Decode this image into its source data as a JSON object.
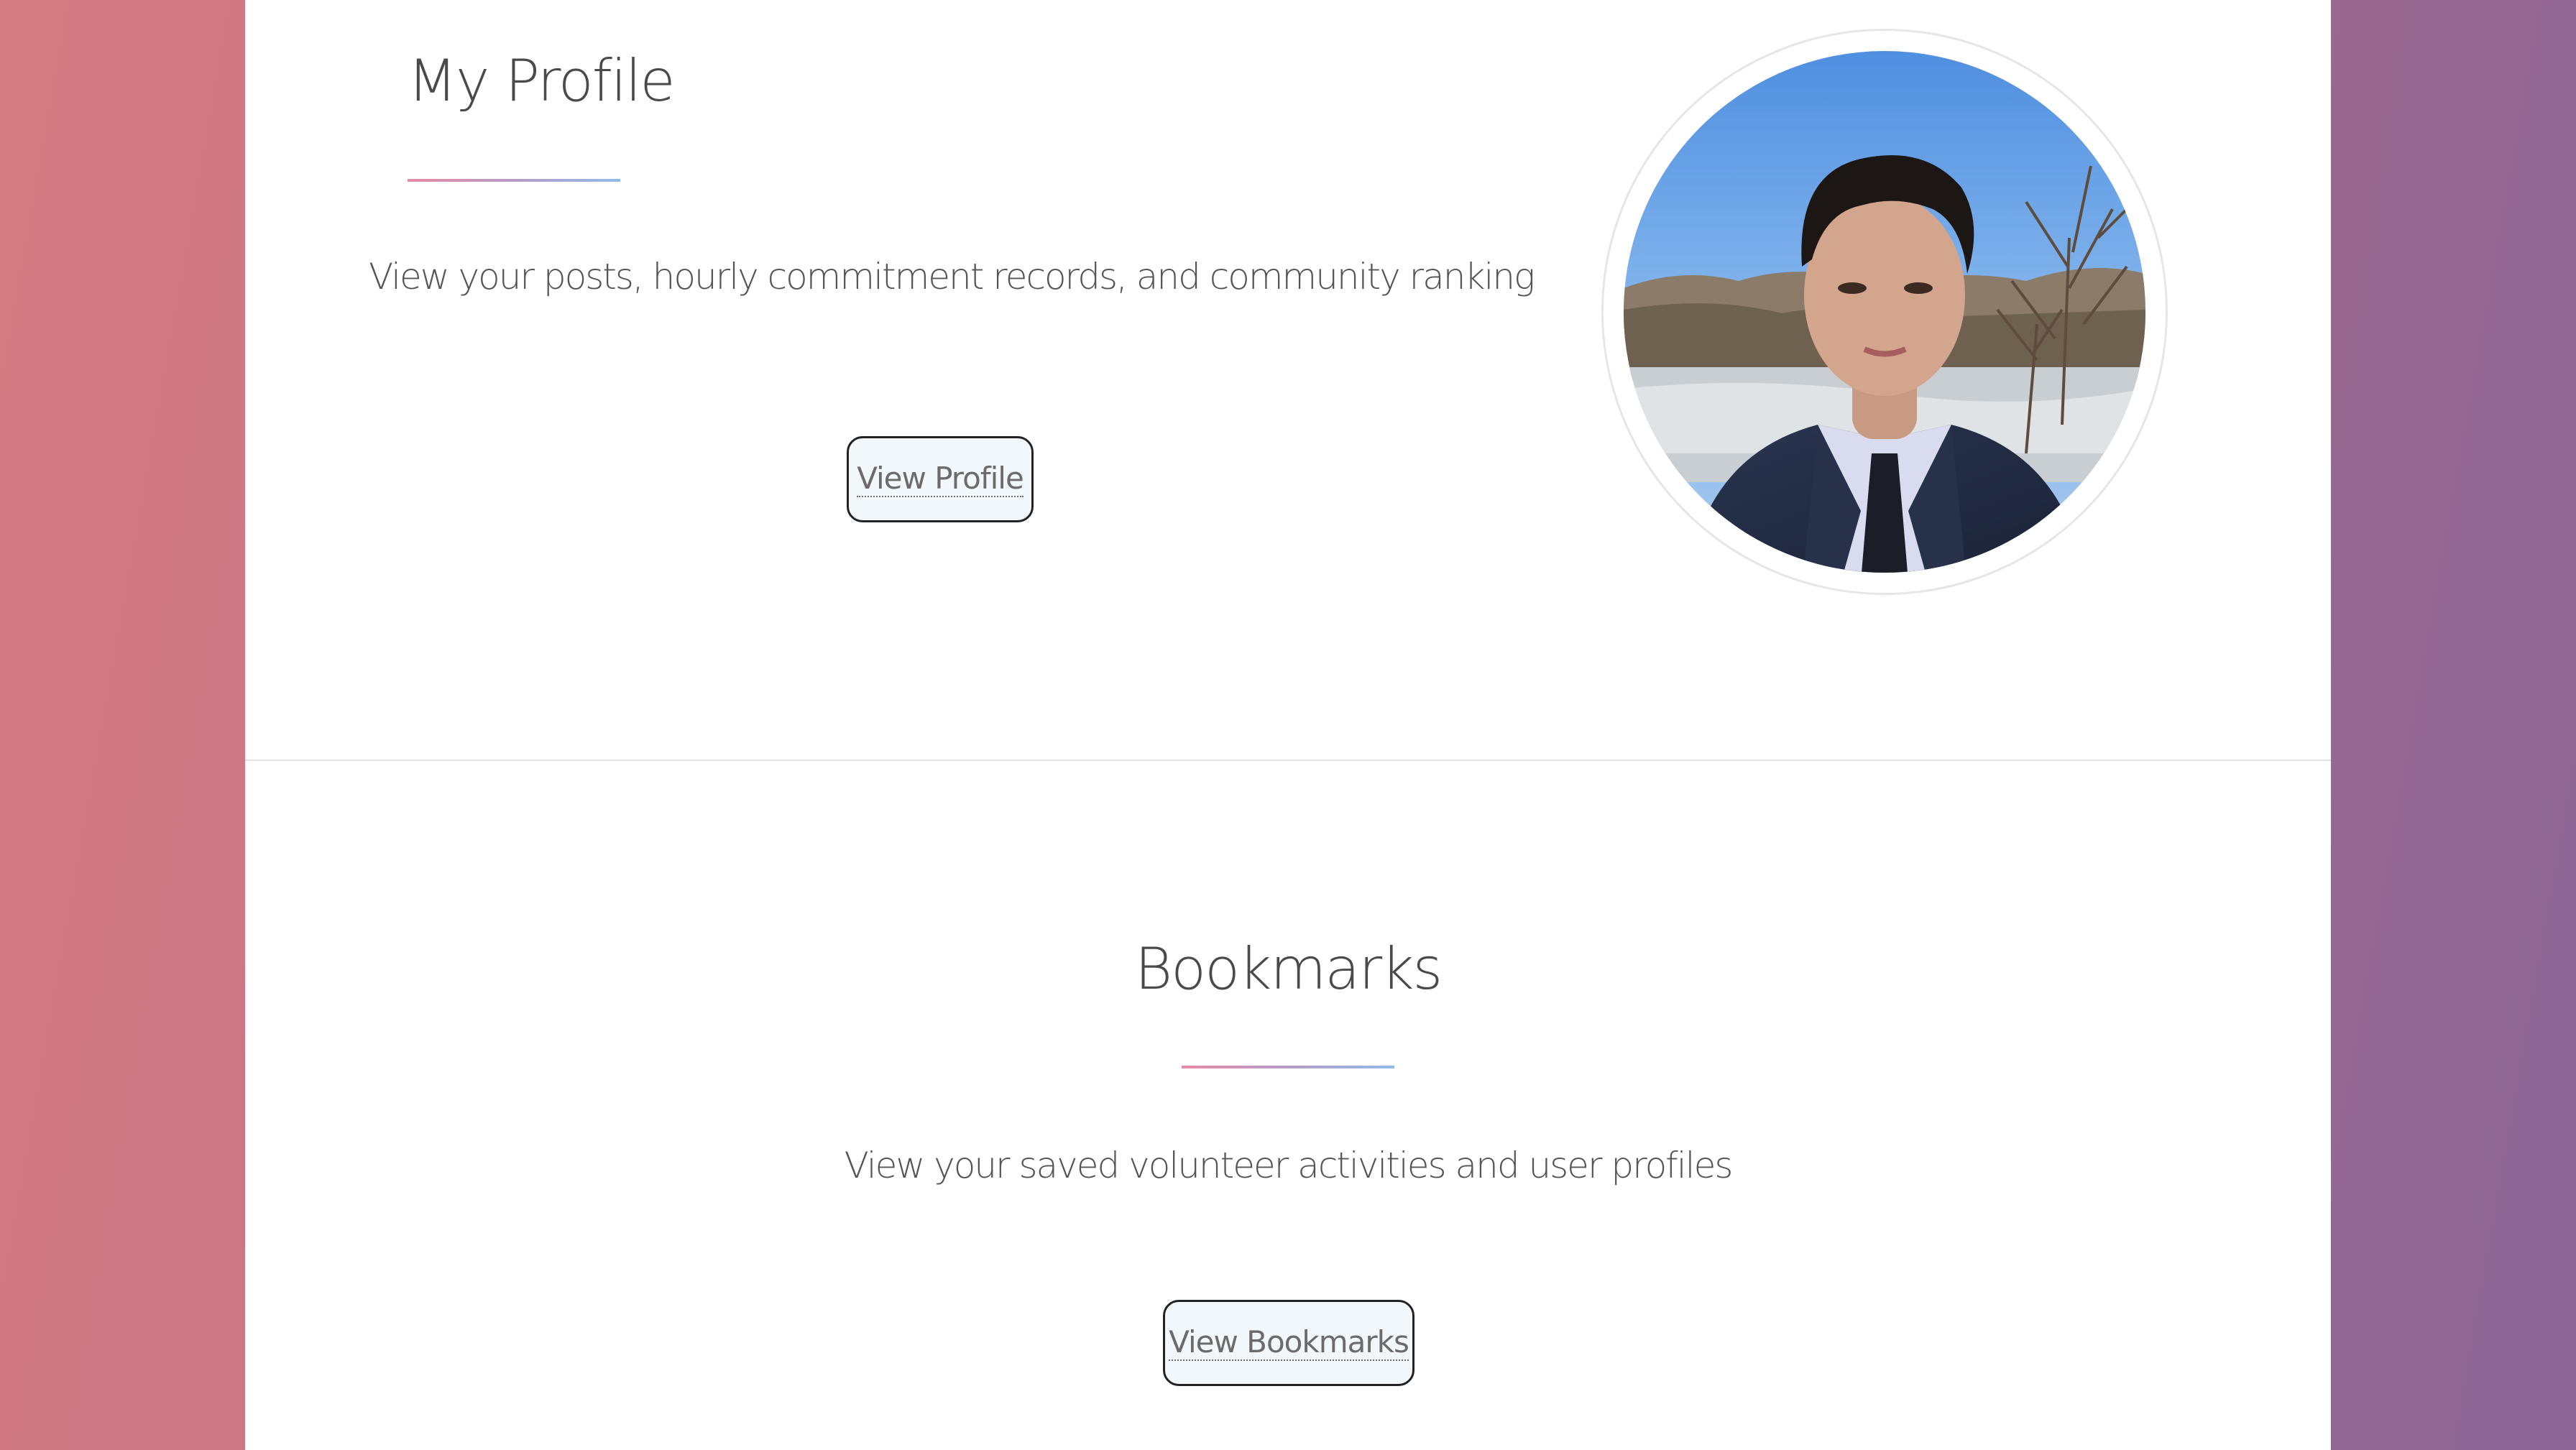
{
  "profile": {
    "title": "My Profile",
    "description": "View your posts, hourly commitment records, and community ranking",
    "button_label": "View Profile",
    "avatar_icon": "user-photo"
  },
  "bookmarks": {
    "title": "Bookmarks",
    "description": "View your saved volunteer activities and user profiles",
    "button_label": "View Bookmarks"
  },
  "colors": {
    "background_start": "#d47a82",
    "background_end": "#8b6696",
    "underline_start": "#e98ba4",
    "underline_end": "#8fbbe8",
    "button_fill": "#f2f7fb"
  }
}
